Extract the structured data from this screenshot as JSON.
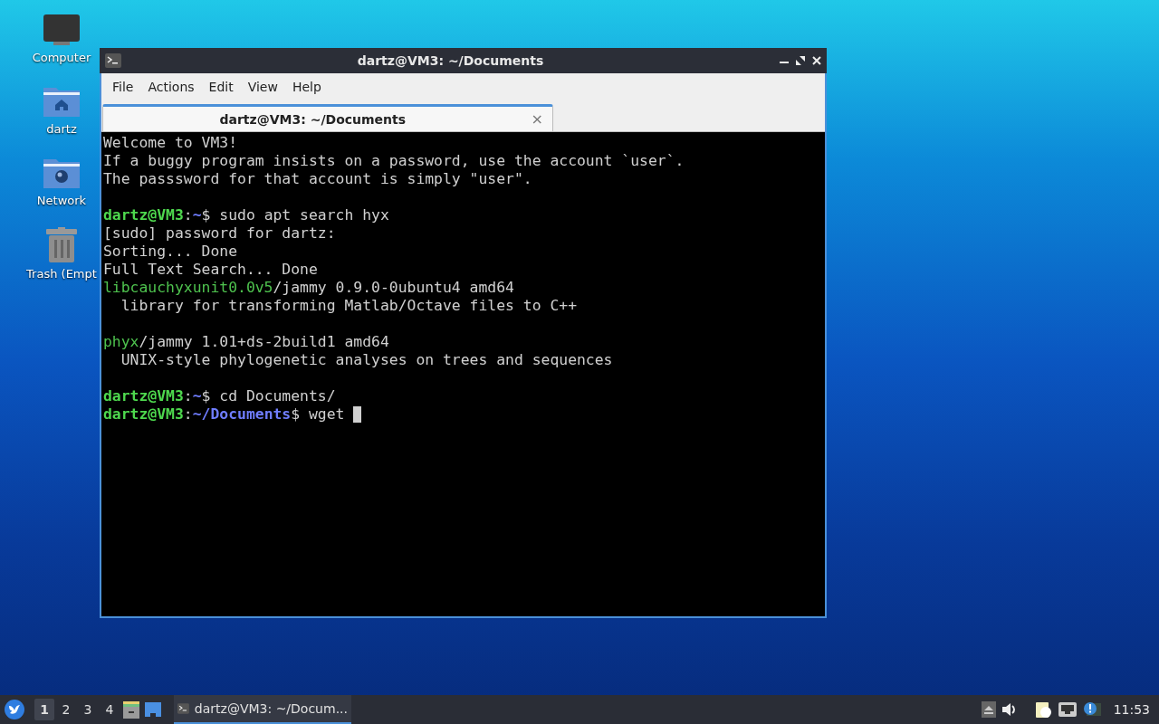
{
  "desktop_icons": [
    {
      "kind": "computer",
      "label": "Computer"
    },
    {
      "kind": "home",
      "label": "dartz"
    },
    {
      "kind": "network",
      "label": "Network"
    },
    {
      "kind": "trash",
      "label": "Trash (Empt"
    }
  ],
  "window": {
    "title": "dartz@VM3: ~/Documents",
    "menu": [
      "File",
      "Actions",
      "Edit",
      "View",
      "Help"
    ],
    "tabs": [
      {
        "label": "dartz@VM3: ~/Documents",
        "selected": true,
        "close": "×"
      }
    ],
    "terminal": {
      "cursor": true,
      "blocks": [
        [
          [
            {
              "kind": "text",
              "text": "Welcome to VM3!"
            }
          ],
          [
            {
              "kind": "text",
              "text": "If a buggy program insists on a password, use the account `user`."
            }
          ],
          [
            {
              "kind": "text",
              "text": "The passsword for that account is simply \"user\"."
            }
          ]
        ],
        [
          [
            {
              "kind": "user",
              "text": "dartz@VM3"
            },
            {
              "kind": "text",
              "text": ":"
            },
            {
              "kind": "path",
              "text": "~"
            },
            {
              "kind": "text",
              "text": "$ sudo apt search hyx"
            }
          ],
          [
            {
              "kind": "text",
              "text": "[sudo] password for dartz:"
            }
          ],
          [
            {
              "kind": "text",
              "text": "Sorting... Done"
            }
          ],
          [
            {
              "kind": "text",
              "text": "Full Text Search... Done"
            }
          ],
          [
            {
              "kind": "package",
              "text": "libcauchyxunit0.0v5"
            },
            {
              "kind": "text",
              "text": "/jammy 0.9.0-0ubuntu4 amd64"
            }
          ],
          [
            {
              "kind": "text",
              "text": "  library for transforming Matlab/Octave files to C++"
            }
          ]
        ],
        [
          [
            {
              "kind": "package",
              "text": "phyx"
            },
            {
              "kind": "text",
              "text": "/jammy 1.01+ds-2build1 amd64"
            }
          ],
          [
            {
              "kind": "text",
              "text": "  UNIX-style phylogenetic analyses on trees and sequences"
            }
          ]
        ],
        [
          [
            {
              "kind": "user",
              "text": "dartz@VM3"
            },
            {
              "kind": "text",
              "text": ":"
            },
            {
              "kind": "path",
              "text": "~"
            },
            {
              "kind": "text",
              "text": "$ cd Documents/"
            }
          ],
          [
            {
              "kind": "user",
              "text": "dartz@VM3"
            },
            {
              "kind": "text",
              "text": ":"
            },
            {
              "kind": "path",
              "text": "~/Documents"
            },
            {
              "kind": "text",
              "text": "$ wget "
            }
          ]
        ]
      ]
    }
  },
  "taskbar": {
    "workspaces": [
      {
        "label": "1",
        "selected": true
      },
      {
        "label": "2",
        "selected": false
      },
      {
        "label": "3",
        "selected": false
      },
      {
        "label": "4",
        "selected": false
      }
    ],
    "tasks": [
      {
        "label": "dartz@VM3: ~/Docum...",
        "selected": true
      }
    ],
    "clock": "11:53"
  }
}
